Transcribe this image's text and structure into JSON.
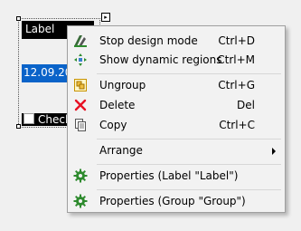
{
  "surface": {
    "label_text": "Label",
    "date_text": "12.09.2024",
    "checkbox_text": "Check"
  },
  "menu": {
    "items": [
      {
        "label": "Stop design mode",
        "shortcut": "Ctrl+D",
        "icon": "design-mode-icon"
      },
      {
        "label": "Show dynamic regions",
        "shortcut": "Ctrl+M",
        "icon": "dynamic-regions-icon"
      },
      {
        "label": "Ungroup",
        "shortcut": "Ctrl+G",
        "icon": "ungroup-icon"
      },
      {
        "label": "Delete",
        "shortcut": "Del",
        "icon": "delete-icon"
      },
      {
        "label": "Copy",
        "shortcut": "Ctrl+C",
        "icon": "copy-icon"
      },
      {
        "label": "Arrange",
        "shortcut": "",
        "icon": "submenu-arrow-icon"
      },
      {
        "label": "Properties (Label \"Label\")",
        "shortcut": "",
        "icon": "gear-icon"
      },
      {
        "label": "Properties (Group \"Group\")",
        "shortcut": "",
        "icon": "gear-icon"
      }
    ]
  },
  "colors": {
    "delete_icon": "#e81123",
    "gear_icon": "#2e8b2e",
    "date_bg": "#0a63c9"
  }
}
